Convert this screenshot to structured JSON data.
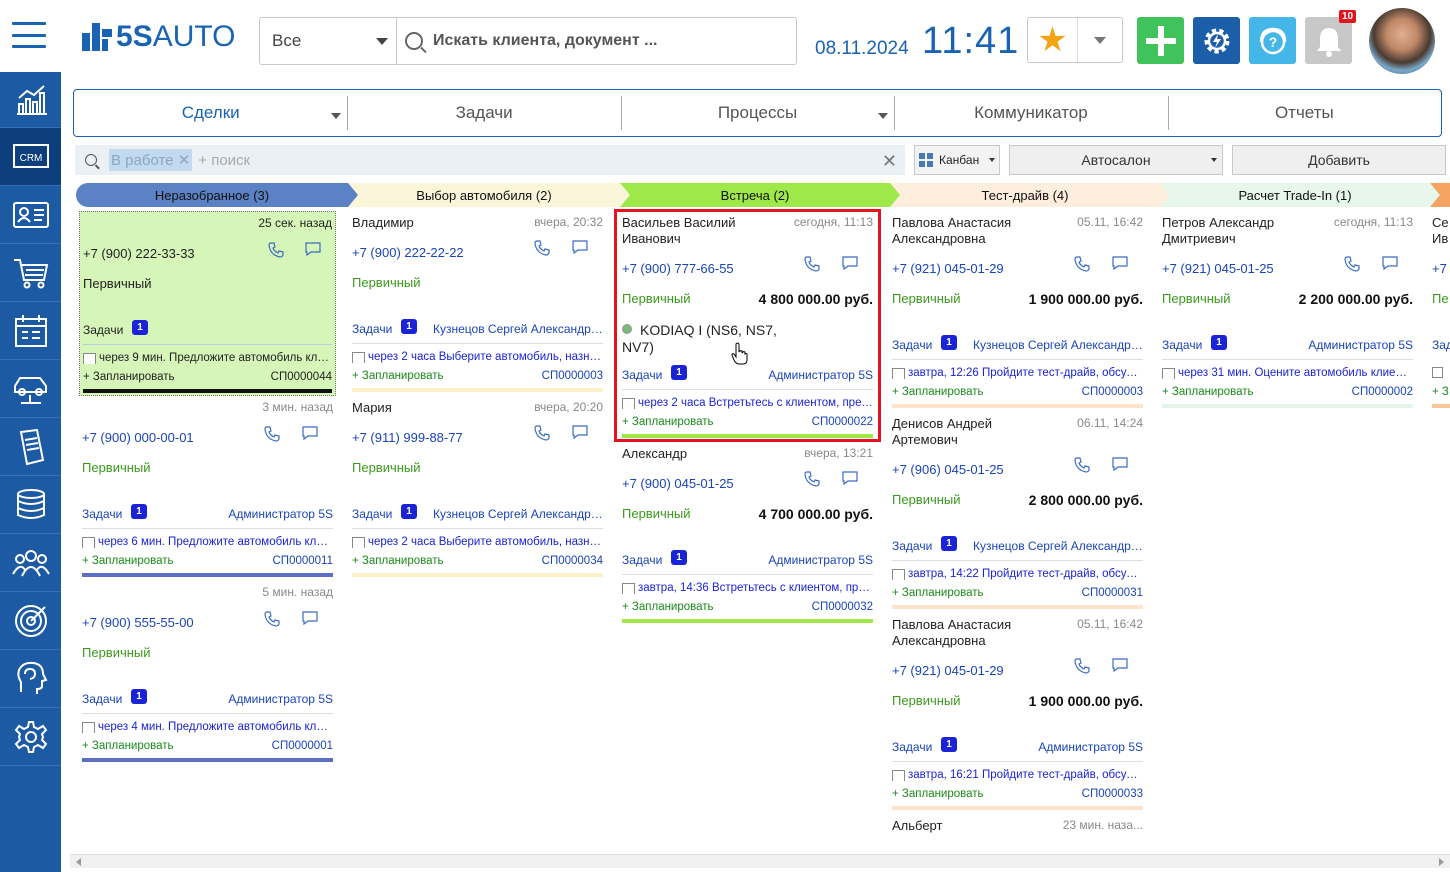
{
  "header": {
    "logo_prefix": "5S",
    "logo_suffix": "AUTO",
    "search_scope": "Все",
    "search_placeholder": "Искать клиента, документ ...",
    "date": "08.11.2024",
    "time": "11:41",
    "notifications_count": "10",
    "icons": [
      "menu-icon",
      "star-icon",
      "plus-icon",
      "gear-icon",
      "help-icon",
      "bell-icon"
    ]
  },
  "sidebar": {
    "items": [
      {
        "name": "analytics"
      },
      {
        "name": "crm",
        "label": "CRM"
      },
      {
        "name": "contacts"
      },
      {
        "name": "cart"
      },
      {
        "name": "calendar"
      },
      {
        "name": "car-service"
      },
      {
        "name": "documents"
      },
      {
        "name": "finance"
      },
      {
        "name": "team"
      },
      {
        "name": "target"
      },
      {
        "name": "support"
      },
      {
        "name": "settings"
      }
    ]
  },
  "tabs": [
    {
      "label": "Сделки",
      "active": true,
      "dropdown": true
    },
    {
      "label": "Задачи",
      "active": false,
      "dropdown": false
    },
    {
      "label": "Процессы",
      "active": false,
      "dropdown": true
    },
    {
      "label": "Коммуникатор",
      "active": false,
      "dropdown": false
    },
    {
      "label": "Отчеты",
      "active": false,
      "dropdown": false
    }
  ],
  "filter": {
    "tag": "В работе",
    "placeholder": "+ поиск",
    "view": "Канбан",
    "showroom": "Автосалон",
    "add_label": "Добавить"
  },
  "stages": [
    {
      "label": "Неразобранное (3)",
      "color": "#5b82c4"
    },
    {
      "label": "Выбор автомобиля (2)",
      "color": "#fbf5d9"
    },
    {
      "label": "Встреча (2)",
      "color": "#9ee84a"
    },
    {
      "label": "Тест-драйв (4)",
      "color": "#fdeedd"
    },
    {
      "label": "Расчет Trade-In (1)",
      "color": "#e8f7ec"
    }
  ],
  "common": {
    "tasks_label": "Задачи",
    "plan_label": "+ Запланировать",
    "status": "Первичный"
  },
  "cards": {
    "c1": {
      "ts": "25 сек. назад",
      "phone": "+7 (900) 222-33-33",
      "count": "1",
      "task": "через 9 мин. Предложите автомобиль клиен...",
      "code": "СП0000044"
    },
    "c2": {
      "ts": "3 мин. назад",
      "phone": "+7 (900) 000-00-01",
      "count": "1",
      "owner": "Администратор 5S",
      "task": "через 6 мин. Предложите автомобиль клиен...",
      "code": "СП0000011"
    },
    "c3": {
      "ts": "5 мин. назад",
      "phone": "+7 (900) 555-55-00",
      "count": "1",
      "owner": "Администратор 5S",
      "task": "через 4 мин. Предложите автомобиль клиен...",
      "code": "СП0000001"
    },
    "c4": {
      "name": "Владимир",
      "ts": "вчера, 20:32",
      "phone": "+7 (900) 222-22-22",
      "count": "1",
      "owner": "Кузнецов Сергей Александров...",
      "task": "через 2 часа Выберите автомобиль, назначь...",
      "code": "СП0000003"
    },
    "c5": {
      "name": "Мария",
      "ts": "вчера, 20:20",
      "phone": "+7 (911) 999-88-77",
      "count": "1",
      "owner": "Кузнецов Сергей Александров...",
      "task": "через 2 часа Выберите автомобиль, назначь...",
      "code": "СП0000034"
    },
    "c6": {
      "name": "Васильев Василий Иванович",
      "ts": "сегодня, 11:13",
      "phone": "+7 (900) 777-66-55",
      "sum": "4 800 000.00 руб.",
      "car": "KODIAQ I (NS6, NS7, NV7)",
      "count": "1",
      "owner": "Администратор 5S",
      "task": "через 2 часа Встретьтесь с клиентом, предл...",
      "code": "СП0000022"
    },
    "c7": {
      "name": "Александр",
      "ts": "вчера, 13:21",
      "phone": "+7 (900) 045-01-25",
      "sum": "4 700 000.00 руб.",
      "count": "1",
      "owner": "Администратор 5S",
      "task": "завтра, 14:36 Встретьтесь с клиентом, пред...",
      "code": "СП0000032"
    },
    "c8": {
      "name": "Павлова Анастасия Александровна",
      "ts": "05.11, 16:42",
      "phone": "+7 (921) 045-01-29",
      "sum": "1 900 000.00 руб.",
      "count": "1",
      "owner": "Кузнецов Сергей Александров...",
      "task": "завтра, 12:26 Пройдите тест-драйв, обсудите...",
      "code": "СП0000003"
    },
    "c9": {
      "name": "Денисов Андрей Артемович",
      "ts": "06.11, 14:24",
      "phone": "+7 (906) 045-01-25",
      "sum": "2 800 000.00 руб.",
      "count": "1",
      "owner": "Кузнецов Сергей Александров...",
      "task": "завтра, 14:22 Пройдите тест-драйв, обсудите...",
      "code": "СП0000031"
    },
    "c10": {
      "name": "Павлова Анастасия Александровна",
      "ts": "05.11, 16:42",
      "phone": "+7 (921) 045-01-29",
      "sum": "1 900 000.00 руб.",
      "count": "1",
      "owner": "Администратор 5S",
      "task": "завтра, 16:21 Пройдите тест-драйв, обсудите...",
      "code": "СП0000033"
    },
    "c11": {
      "name": "Альберт",
      "ts": "23 мин. наза..."
    },
    "c12": {
      "name": "Петров Александр Дмитриевич",
      "ts": "сегодня, 11:13",
      "phone": "+7 (921) 045-01-25",
      "sum": "2 200 000.00 руб.",
      "count": "1",
      "owner": "Администратор 5S",
      "task": "через 31 мин. Оцените автомобиль клиента ...",
      "code": "СП0000002"
    },
    "c13": {
      "name": "Се Ив",
      "phone": "+7",
      "status_short": "Пе",
      "tasks_short": "Зад",
      "plan_short": "+ З"
    }
  }
}
